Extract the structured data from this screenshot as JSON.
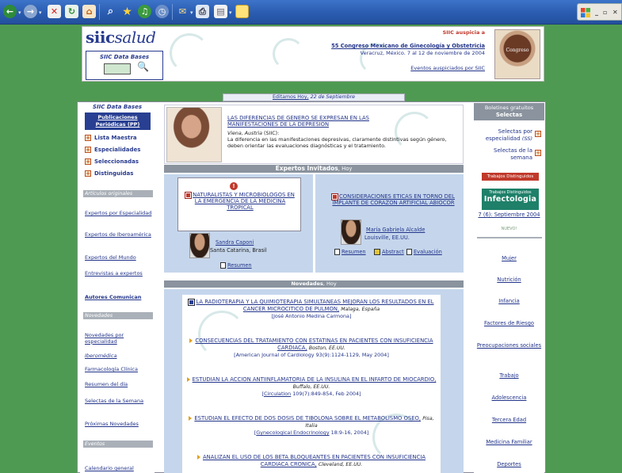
{
  "colors": {
    "background": "#4f9a52",
    "toolbar": "#2a5cb0",
    "link": "#22348a",
    "brand": "#283b8e",
    "accent_red": "#c0392b"
  },
  "header": {
    "logo": {
      "bold": "siic",
      "italic": "salud"
    },
    "databases_label": "SIIC Data Bases",
    "auspicia": "SIIC auspicia a",
    "congress_title": "55 Congreso Mexicano de Ginecología y Obstetricia",
    "congress_place": "Veracruz, México. 7 al 12 de noviembre de 2004",
    "events_link": "Eventos auspiciados por SIIC",
    "poster_text": "Congreso"
  },
  "date_bar": {
    "prefix": "Editamos Hoy,",
    "date": "22 de Septiembre"
  },
  "left": {
    "title": "SIIC Data Bases",
    "pub_button": "Publicaciones Periódicas (PP)",
    "items": [
      "Lista Maestra",
      "Especialidades",
      "Seleccionadas",
      "Distinguidas"
    ],
    "bar_originales": "Artículos originales",
    "links1": [
      "Expertos por Especialidad",
      "Expertos de Iberoamérica",
      "Expertos del Mundo",
      "Entrevistas a expertos",
      "Autores Comunican"
    ],
    "bar_novedades": "Novedades",
    "links2": [
      "Novedades por especialidad",
      "Iberoméd​ica",
      "Farmacología Clínica",
      "Resumen del día",
      "Selectas de la Semana",
      "Próximas Novedades"
    ],
    "bar_eventos": "Eventos",
    "links3": [
      "Calendario general"
    ]
  },
  "featured": {
    "title": "LAS DIFERENCIAS DE GENERO SE EXPRESAN EN LAS MANIFESTACIONES DE LA DEPRESION",
    "location": "Viena, Austria",
    "source": "(SIIC):",
    "text": "La diferencia en las manifestaciones depresivas, claramente distintivas según género, deben orientar las evaluaciones diagnósticas y el tratamiento."
  },
  "experts": {
    "title": "Expertos Invitados",
    "suffix": ", Hoy",
    "left": {
      "title": "NATURALISTAS Y MICROBIOLOGOS EN LA EMERGENCIA DE LA MEDICINA TROPICAL",
      "author": "Sandra Caponi",
      "place": "Santa Catarina, Brasil",
      "resumen": "Resumen"
    },
    "right": {
      "title": "CONSIDERACIONES ETICAS EN TORNO DEL IMPLANTE DE CORAZON ARTIFICIAL ABIOCOR",
      "author": "María Gabriela Alcalde",
      "place": "Louisville, EE.UU.",
      "resumen": "Resumen",
      "abstract": "Abstract",
      "evaluacion": "Evaluación"
    }
  },
  "novedades": {
    "title": "Novedades",
    "suffix": ", Hoy",
    "items": [
      {
        "title": "LA RADIOTERAPIA Y LA QUIMIOTERAPIA SIMULTANEAS MEJORAN LOS RESULTADOS EN EL CANCER MICROCITICO DE PULMON,",
        "city": "Malaga, España",
        "ref": "[José Antonio Medina Carmona]"
      },
      {
        "title": "CONSECUENCIAS DEL TRATAMIENTO CON ESTATINAS EN PACIENTES CON INSUFICIENCIA CARDIACA,",
        "city": "Boston, EE.UU.",
        "ref": "[American Journal of Cardiology 93(9):1124-1129, May 2004]"
      },
      {
        "title": "ESTUDIAN LA ACCION ANTIINFLAMATORIA DE LA INSULINA EN EL INFARTO DE MIOCARDIO,",
        "city": "Buffalo, EE.UU.",
        "ref_link": "Circulation",
        "ref": " 109(7):849-854, Feb 2004]"
      },
      {
        "title": "ESTUDIAN EL EFECTO DE DOS DOSIS DE TIBOLONA SOBRE EL METABOLISMO OSEO,",
        "city": "Pisa, Italia",
        "ref_link": "Gynecological Endocrinology",
        "ref": " 18:9-16, 2004]"
      },
      {
        "title": "ANALIZAN EL USO DE LOS BETA BLOQUEANTES EN PACIENTES CON INSUFICIENCIA CARDIACA CRONICA,",
        "city": "Cleveland, EE.UU."
      }
    ]
  },
  "right": {
    "boletines": "Boletines gratuitos",
    "selectas": "Selectas",
    "selectas_esp": "Selectas por especialidad",
    "ss": "(SS)",
    "selectas_semana": "Selectas de la semana",
    "trabajos": "Trabajos Distinguidos",
    "infect_small": "Trabajos Distinguidos",
    "infect_big": "Infectologia",
    "issue": "7 (6): Septiembre 2004",
    "nuevo": "NUEVO!",
    "links": [
      "Mujer",
      "Nutrición",
      "Infancia",
      "Factores de Riesgo",
      "Preocupaciones sociales",
      "Trabajo",
      "Adolescencia",
      "Tercera Edad",
      "Medicina Familiar",
      "Deportes"
    ]
  }
}
